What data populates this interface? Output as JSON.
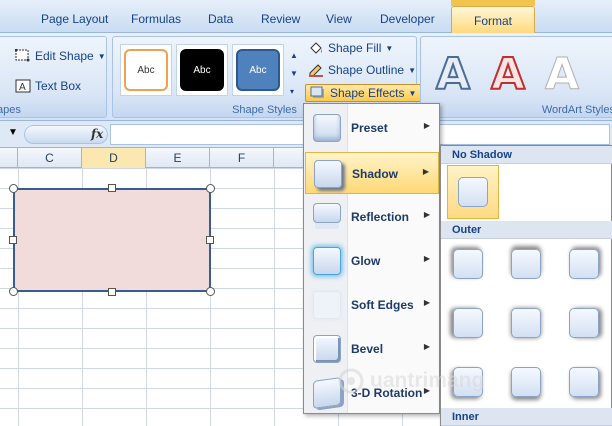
{
  "tabs": {
    "page_layout": "Page Layout",
    "formulas": "Formulas",
    "data": "Data",
    "review": "Review",
    "view": "View",
    "developer": "Developer",
    "format": "Format"
  },
  "ribbon": {
    "insert_shapes": {
      "edit_shape": "Edit Shape",
      "text_box": "Text Box",
      "group_label_partial": "apes"
    },
    "shape_styles": {
      "styles": [
        "Abc",
        "Abc",
        "Abc"
      ],
      "shape_fill": "Shape Fill",
      "shape_outline": "Shape Outline",
      "shape_effects": "Shape Effects",
      "group_label": "Shape Styles"
    },
    "wordart_styles": {
      "letters": [
        "A",
        "A",
        "A"
      ],
      "group_label": "WordArt Styles"
    }
  },
  "formula_bar": {
    "fx": "fx",
    "value": ""
  },
  "columns": [
    "C",
    "D",
    "E",
    "F"
  ],
  "shape_effects_menu": {
    "items": [
      {
        "label": "Preset",
        "icon": "preset-icon"
      },
      {
        "label": "Shadow",
        "icon": "shadow-icon"
      },
      {
        "label": "Reflection",
        "icon": "reflection-icon"
      },
      {
        "label": "Glow",
        "icon": "glow-icon"
      },
      {
        "label": "Soft Edges",
        "icon": "soft-edges-icon"
      },
      {
        "label": "Bevel",
        "icon": "bevel-icon"
      },
      {
        "label": "3-D Rotation",
        "icon": "3d-rotation-icon"
      }
    ],
    "active": "Shadow"
  },
  "shadow_submenu": {
    "no_shadow": "No Shadow",
    "outer": "Outer",
    "inner": "Inner"
  },
  "watermark": "uantrimang",
  "colors": {
    "shape_fill": "#f2dcdb",
    "shape_outline": "#375d92",
    "accent": "#ffd877"
  }
}
